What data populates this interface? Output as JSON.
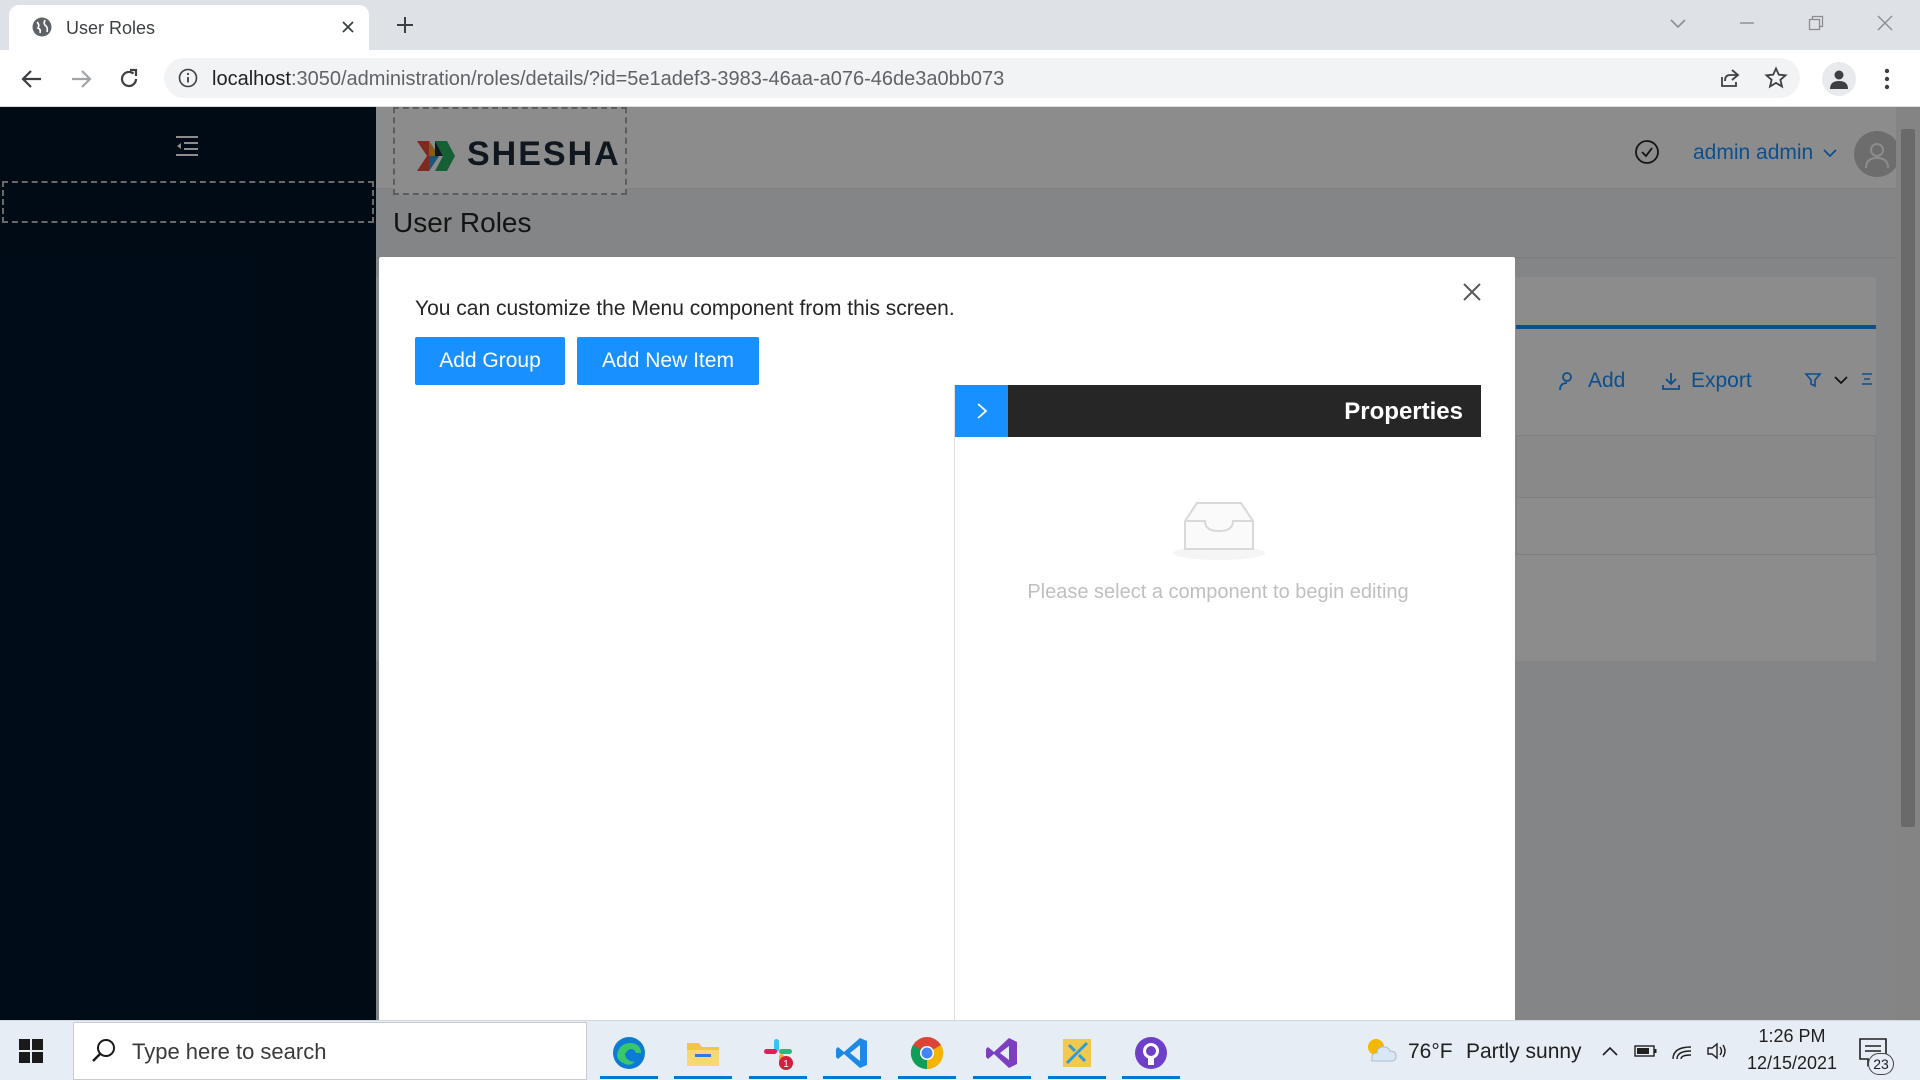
{
  "browser": {
    "tab_title": "User Roles",
    "url_host": "localhost",
    "url_rest": ":3050/administration/roles/details/?id=5e1adef3-3983-46aa-a076-46de3a0bb073"
  },
  "header": {
    "logo_text": "SHESHA",
    "user_name": "admin admin"
  },
  "page": {
    "title": "User Roles"
  },
  "background_toolbar": {
    "add_label": "Add",
    "export_label": "Export"
  },
  "modal": {
    "description": "You can customize the Menu component from this screen.",
    "add_group_label": "Add Group",
    "add_item_label": "Add New Item",
    "properties": {
      "title": "Properties",
      "empty_text": "Please select a component to begin editing"
    }
  },
  "taskbar": {
    "search_placeholder": "Type here to search",
    "apps": [
      "edge-icon",
      "file-explorer-icon",
      "slack-icon",
      "vscode-icon",
      "chrome-icon",
      "visual-studio-icon",
      "app-icon",
      "github-desktop-icon"
    ],
    "slack_badge": "1",
    "weather_temp": "76°F",
    "weather_condition": "Partly sunny",
    "time": "1:26 PM",
    "date": "12/15/2021",
    "notification_count": "23"
  },
  "colors": {
    "primary": "#1890ff",
    "sider": "#001529",
    "properties_header": "#262626"
  }
}
